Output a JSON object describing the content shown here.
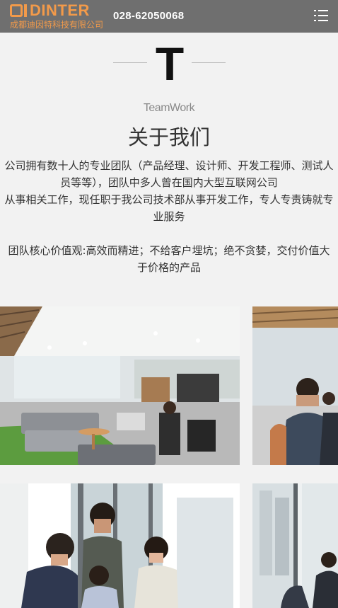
{
  "header": {
    "logo": {
      "brand": "DINTER",
      "company": "成都迪因特科技有限公司"
    },
    "phone": "028-62050068",
    "menu_icon": "hamburger-menu-icon"
  },
  "section": {
    "letter": "T",
    "subtitle_en": "TeamWork",
    "title": "关于我们",
    "paragraphs": [
      "公司拥有数十人的专业团队（产品经理、设计师、开发工程师、测试人员等等），团队中多人曾在国内大型互联网公司",
      "从事相关工作，现任职于我公司技术部从事开发工作，专人专责铸就专业服务",
      "团队核心价值观:高效而精进；不给客户埋坑；绝不贪婪，交付价值大于价格的产品"
    ]
  },
  "gallery": [
    "office-photo",
    "meeting-photo",
    "team-photo",
    "workspace-photo"
  ],
  "colors": {
    "header_bg": "#6f6f6f",
    "brand_orange": "#f29a4a",
    "page_bg": "#f2f2f2"
  }
}
